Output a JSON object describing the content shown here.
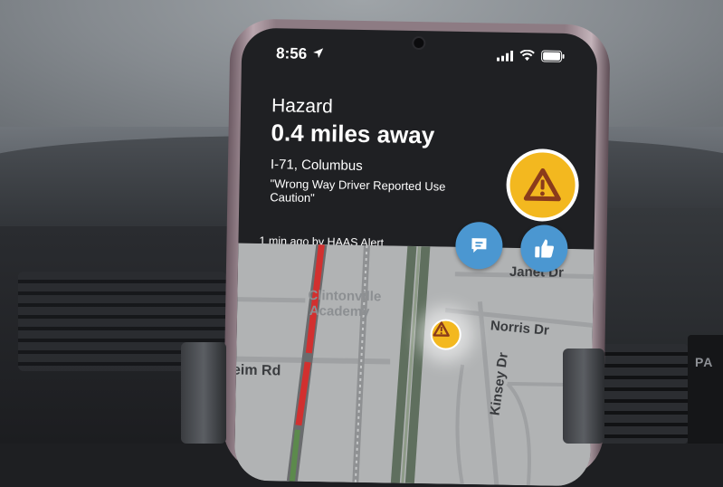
{
  "status_bar": {
    "time": "8:56",
    "location_icon": "location-arrow-icon",
    "signal_icon": "cell-signal-icon",
    "wifi_icon": "wifi-icon",
    "battery_icon": "battery-icon"
  },
  "alert": {
    "type": "Hazard",
    "distance": "0.4 miles away",
    "road": "I-71, Columbus",
    "message": "\"Wrong Way Driver Reported Use Caution\"",
    "meta": "1 min ago by HAAS Alert",
    "badge_icon": "warning-triangle-icon",
    "badge_color": "#f3b81f"
  },
  "actions": {
    "comment_icon": "comment-icon",
    "thumbs_up_icon": "thumbs-up-icon",
    "button_color": "#4b97d1"
  },
  "map": {
    "labels": {
      "janet": "Janet Dr",
      "norris": "Norris Dr",
      "kinsey": "Kinsey Dr",
      "rd": "eim Rd",
      "school": "Clintonville Academy"
    },
    "pin_icon": "warning-triangle-icon",
    "traffic_color": "#d2302f"
  },
  "background": {
    "vent_label": "PA"
  }
}
